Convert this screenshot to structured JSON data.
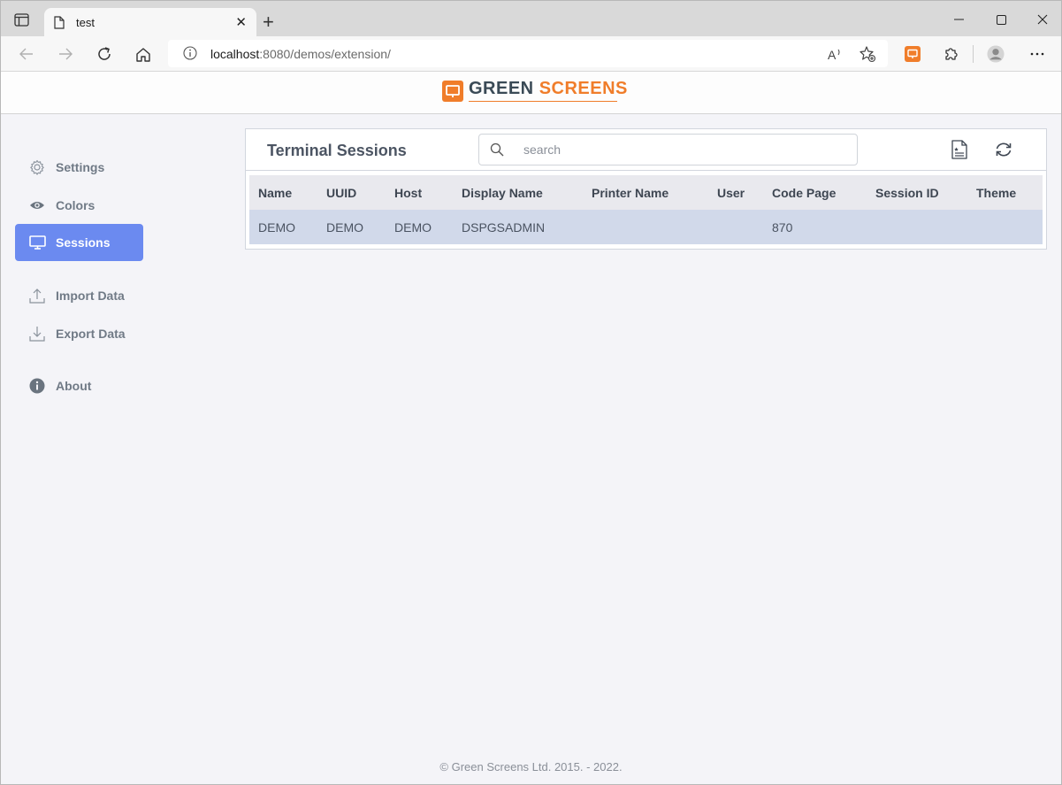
{
  "browser": {
    "tab_title": "test",
    "url_host": "localhost",
    "url_rest": ":8080/demos/extension/"
  },
  "app": {
    "logo_green": "GREEN",
    "logo_screens": "SCREENS",
    "brand_color": "#f07d2a"
  },
  "nav": {
    "settings": "Settings",
    "colors": "Colors",
    "sessions": "Sessions",
    "import": "Import Data",
    "export": "Export Data",
    "about": "About",
    "active_color": "#6b8af0"
  },
  "panel": {
    "title": "Terminal Sessions",
    "search_placeholder": "search",
    "columns": [
      "Name",
      "UUID",
      "Host",
      "Display Name",
      "Printer Name",
      "User",
      "Code Page",
      "Session ID",
      "Theme"
    ],
    "rows": [
      [
        "DEMO",
        "DEMO",
        "DEMO",
        "DSPGSADMIN",
        "",
        "",
        "870",
        "",
        ""
      ]
    ]
  },
  "footer": {
    "text": "© Green Screens Ltd. 2015. - 2022."
  }
}
